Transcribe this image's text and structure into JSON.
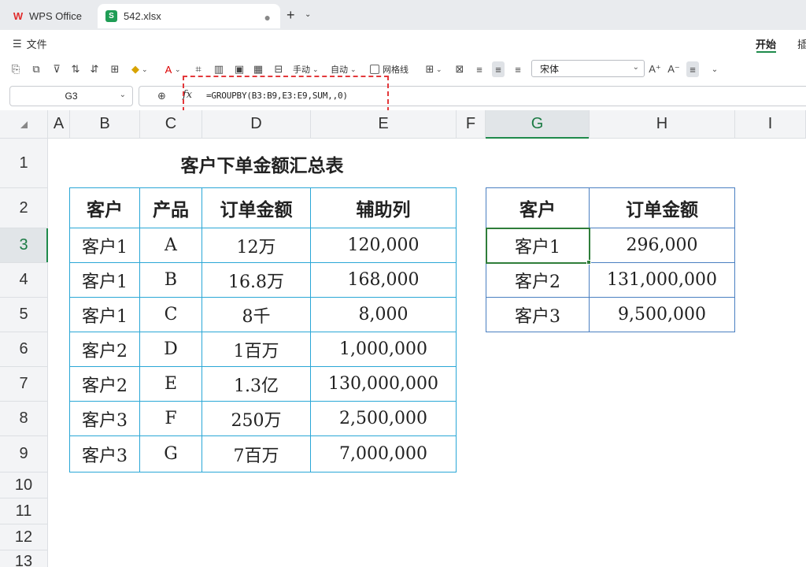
{
  "app": {
    "tab_wps": "WPS Office",
    "tab_file": "542.xlsx"
  },
  "menu": {
    "file": "文件",
    "start": "开始",
    "insert": "插"
  },
  "toolbar": {
    "manual": "手动",
    "auto": "自动",
    "gridlines": "网格线",
    "font": "宋体"
  },
  "formula_bar": {
    "name_box": "G3",
    "fx": "fx",
    "formula": "=GROUPBY(B3:B9,E3:E9,SUM,,0)"
  },
  "grid": {
    "columns": [
      "A",
      "B",
      "C",
      "D",
      "E",
      "F",
      "G",
      "H",
      "I"
    ],
    "rows": [
      "1",
      "2",
      "3",
      "4",
      "5",
      "6",
      "7",
      "8",
      "9",
      "10",
      "11",
      "12",
      "13"
    ],
    "active_column": "G",
    "active_row": "3"
  },
  "sheet": {
    "title": "客户下单金额汇总表",
    "table1": {
      "headers": [
        "客户",
        "产品",
        "订单金额",
        "辅助列"
      ],
      "rows": [
        [
          "客户1",
          "A",
          "12万",
          "120,000"
        ],
        [
          "客户1",
          "B",
          "16.8万",
          "168,000"
        ],
        [
          "客户1",
          "C",
          "8千",
          "8,000"
        ],
        [
          "客户2",
          "D",
          "1百万",
          "1,000,000"
        ],
        [
          "客户2",
          "E",
          "1.3亿",
          "130,000,000"
        ],
        [
          "客户3",
          "F",
          "250万",
          "2,500,000"
        ],
        [
          "客户3",
          "G",
          "7百万",
          "7,000,000"
        ]
      ]
    },
    "table2": {
      "headers": [
        "客户",
        "订单金额"
      ],
      "rows": [
        [
          "客户1",
          "296,000"
        ],
        [
          "客户2",
          "131,000,000"
        ],
        [
          "客户3",
          "9,500,000"
        ]
      ]
    }
  },
  "colors": {
    "accent_green": "#1e8a4b",
    "table1_border": "#2aa7d6",
    "table2_border": "#4a7fc1",
    "annotation_red": "#e3383b"
  }
}
